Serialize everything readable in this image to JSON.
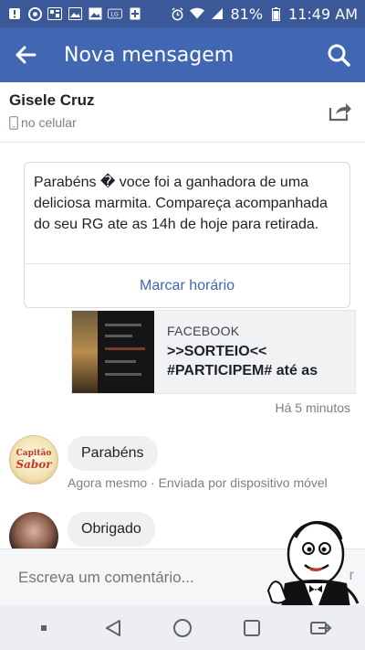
{
  "status_bar": {
    "battery": "81%",
    "time": "11:49 AM",
    "left_icons": [
      "alert-icon",
      "chrome-icon",
      "qr-icon",
      "image-icon",
      "gallery-icon",
      "lg-icon",
      "plus-icon"
    ],
    "right_icons": [
      "alarm-icon",
      "wifi-icon",
      "signal-icon",
      "battery-icon"
    ]
  },
  "app_bar": {
    "title": "Nova mensagem"
  },
  "contact": {
    "name": "Gisele Cruz",
    "subtitle": "no celular"
  },
  "message": {
    "text": "Parabéns � voce foi a ganhadora de uma deliciosa marmita. Compareça acompanhada do seu RG ate as 14h de hoje para retirada.",
    "action_label": "Marcar horário"
  },
  "link_preview": {
    "site": "FACEBOOK",
    "headline_line1": ">>SORTEIO<<",
    "headline_line2": "#PARTICIPEM# até as"
  },
  "timestamp": "Há 5 minutos",
  "replies": [
    {
      "avatar_text_top": "Capitão",
      "avatar_text_bottom": "Sabor",
      "text": "Parabéns",
      "meta": "Agora mesmo · Enviada por dispositivo móvel"
    },
    {
      "text": "Obrigado"
    }
  ],
  "composer": {
    "placeholder": "Escreva um comentário...",
    "send_label": "r"
  },
  "colors": {
    "status_bar": "#3b5998",
    "app_bar": "#4267b2",
    "link": "#4267b2",
    "bubble": "#f1f0f0"
  }
}
